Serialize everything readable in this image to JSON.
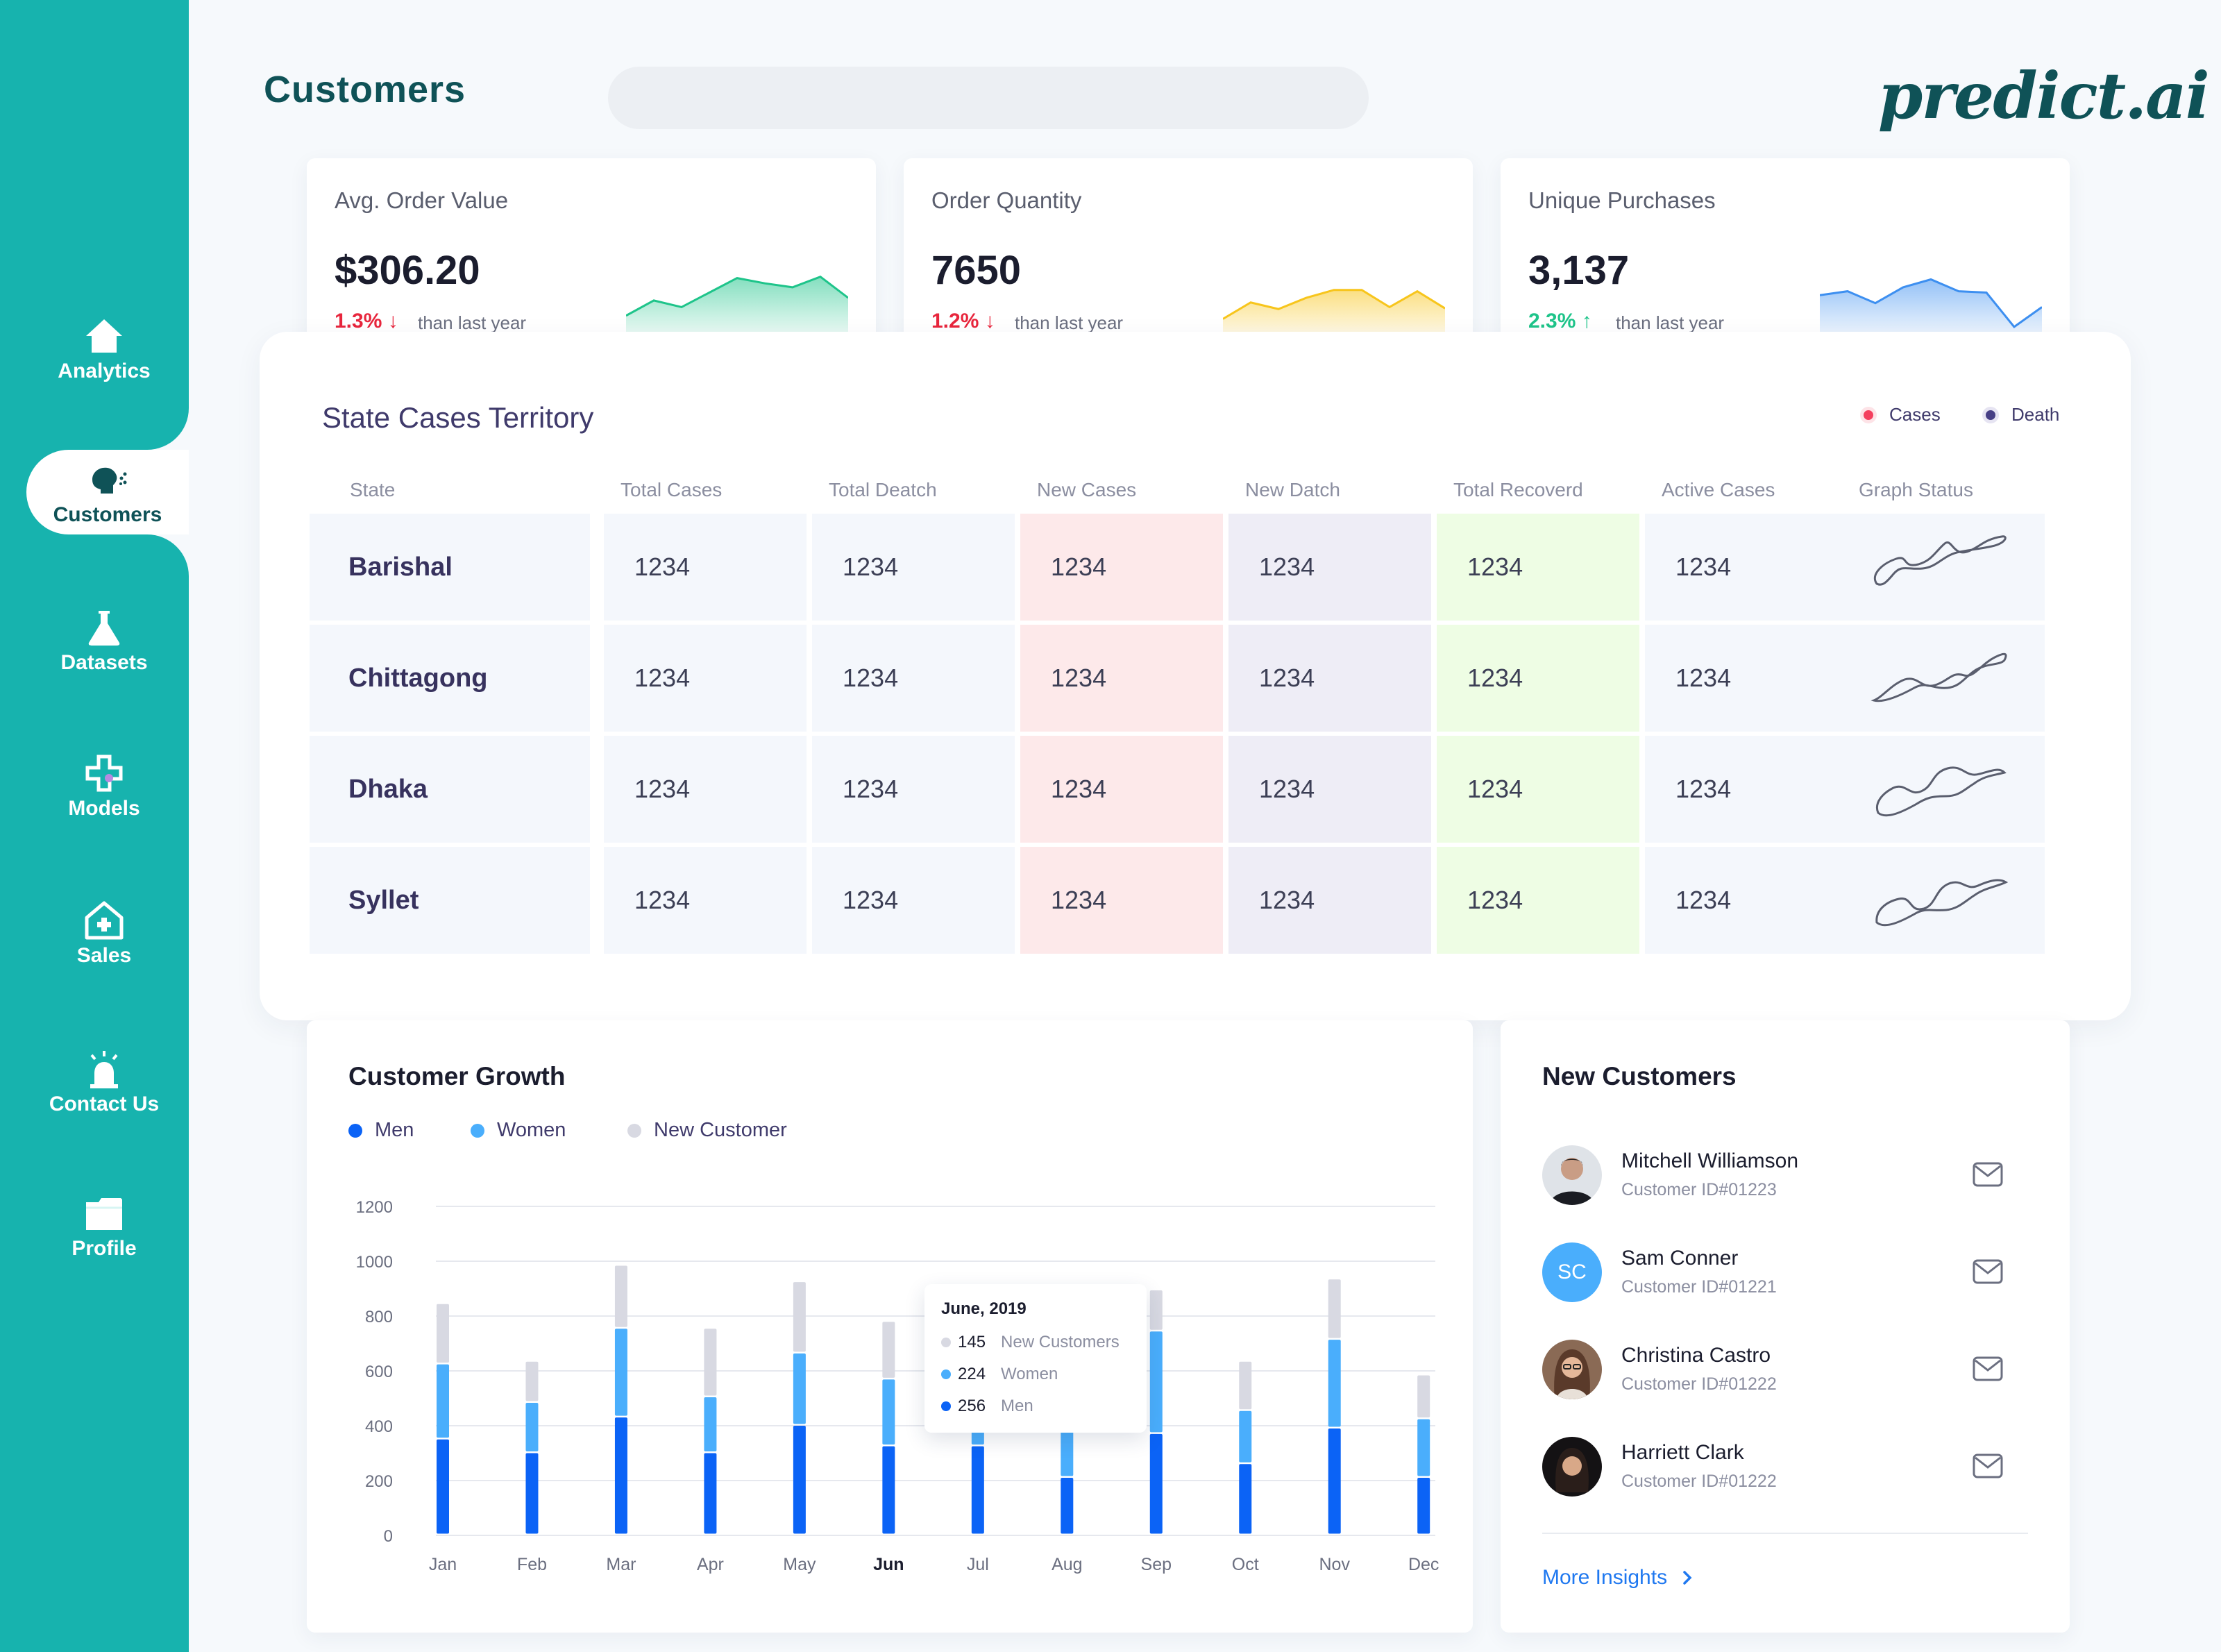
{
  "sidebar": {
    "items": [
      {
        "label": "Analytics",
        "icon": "home-icon"
      },
      {
        "label": "Customers",
        "icon": "user-voice-icon"
      },
      {
        "label": "Datasets",
        "icon": "flask-icon"
      },
      {
        "label": "Models",
        "icon": "medical-cross-icon"
      },
      {
        "label": "Sales",
        "icon": "house-plus-icon"
      },
      {
        "label": "Contact Us",
        "icon": "alarm-icon"
      },
      {
        "label": "Profile",
        "icon": "folder-icon"
      }
    ],
    "active": "Customers",
    "color": "#17b3ae"
  },
  "header": {
    "title": "Customers",
    "search_placeholder": "",
    "logo": "predict.ai"
  },
  "stats": [
    {
      "label": "Avg. Order Value",
      "value": "$306.20",
      "change": "1.3%",
      "direction": "down",
      "note": "than last year",
      "color": "#1ec48a",
      "spark": [
        35,
        58,
        48,
        70,
        92,
        84,
        78,
        94,
        62
      ]
    },
    {
      "label": "Order Quantity",
      "value": "7650",
      "change": "1.2%",
      "direction": "down",
      "note": "than last year",
      "color": "#f7c51c",
      "spark": [
        30,
        55,
        45,
        62,
        74,
        74,
        48,
        72,
        46
      ]
    },
    {
      "label": "Unique Purchases",
      "value": "3,137",
      "change": "2.3%",
      "direction": "up",
      "note": "than last year",
      "color": "#3d8ff0",
      "spark": [
        66,
        72,
        54,
        78,
        90,
        72,
        70,
        18,
        48
      ]
    }
  ],
  "territory": {
    "title": "State Cases Territory",
    "legend": [
      {
        "label": "Cases",
        "color": "#f43f5e"
      },
      {
        "label": "Death",
        "color": "#463f85"
      }
    ],
    "columns": [
      "State",
      "Total Cases",
      "Total Deatch",
      "New Cases",
      "New Datch",
      "Total Recoverd",
      "Active Cases",
      "Graph Status"
    ],
    "rows": [
      {
        "state": "Barishal",
        "values": [
          "1234",
          "1234",
          "1234",
          "1234",
          "1234",
          "1234"
        ]
      },
      {
        "state": "Chittagong",
        "values": [
          "1234",
          "1234",
          "1234",
          "1234",
          "1234",
          "1234"
        ]
      },
      {
        "state": "Dhaka",
        "values": [
          "1234",
          "1234",
          "1234",
          "1234",
          "1234",
          "1234"
        ]
      },
      {
        "state": "Syllet",
        "values": [
          "1234",
          "1234",
          "1234",
          "1234",
          "1234",
          "1234"
        ]
      }
    ],
    "column_colors": [
      "#f4f7fc",
      "#f4f7fc",
      "#f4f7fc",
      "#fde9ea",
      "#eeedf6",
      "#eefde4",
      "#f4f7fc",
      "#f4f7fc"
    ]
  },
  "growth": {
    "title": "Customer Growth",
    "legend": [
      {
        "label": "Men",
        "color": "#0b63f6"
      },
      {
        "label": "Women",
        "color": "#4aaefc"
      },
      {
        "label": "New Customer",
        "color": "#d8d9e2"
      }
    ],
    "tooltip": {
      "title": "June, 2019",
      "rows": [
        {
          "value": "145",
          "label": "New Customers",
          "color": "#d8d9e2"
        },
        {
          "value": "224",
          "label": "Women",
          "color": "#4aaefc"
        },
        {
          "value": "256",
          "label": "Men",
          "color": "#0b63f6"
        }
      ]
    }
  },
  "chart_data": {
    "type": "bar",
    "stacked": true,
    "categories": [
      "Jan",
      "Feb",
      "Mar",
      "Apr",
      "May",
      "Jun",
      "Jul",
      "Aug",
      "Sep",
      "Oct",
      "Nov",
      "Dec"
    ],
    "highlight": "Jun",
    "series": [
      {
        "name": "Men",
        "values": [
          350,
          300,
          430,
          300,
          400,
          325,
          325,
          210,
          370,
          260,
          390,
          210
        ]
      },
      {
        "name": "Women",
        "values": [
          280,
          190,
          330,
          210,
          270,
          250,
          310,
          320,
          380,
          200,
          330,
          220
        ]
      },
      {
        "name": "New Customer",
        "values": [
          220,
          150,
          230,
          250,
          260,
          210,
          150,
          100,
          150,
          180,
          220,
          160
        ]
      }
    ],
    "ylim": [
      0,
      1200
    ],
    "yticks": [
      0,
      200,
      400,
      600,
      800,
      1000,
      1200
    ],
    "grid": true
  },
  "new_customers": {
    "title": "New Customers",
    "list": [
      {
        "name": "Mitchell Williamson",
        "id": "Customer ID#01223",
        "avatar": "photo"
      },
      {
        "name": "Sam Conner",
        "id": "Customer ID#01221",
        "avatar": "SC"
      },
      {
        "name": "Christina Castro",
        "id": "Customer ID#01222",
        "avatar": "photo"
      },
      {
        "name": "Harriett Clark",
        "id": "Customer ID#01222",
        "avatar": "photo"
      }
    ],
    "more_label": "More Insights"
  }
}
